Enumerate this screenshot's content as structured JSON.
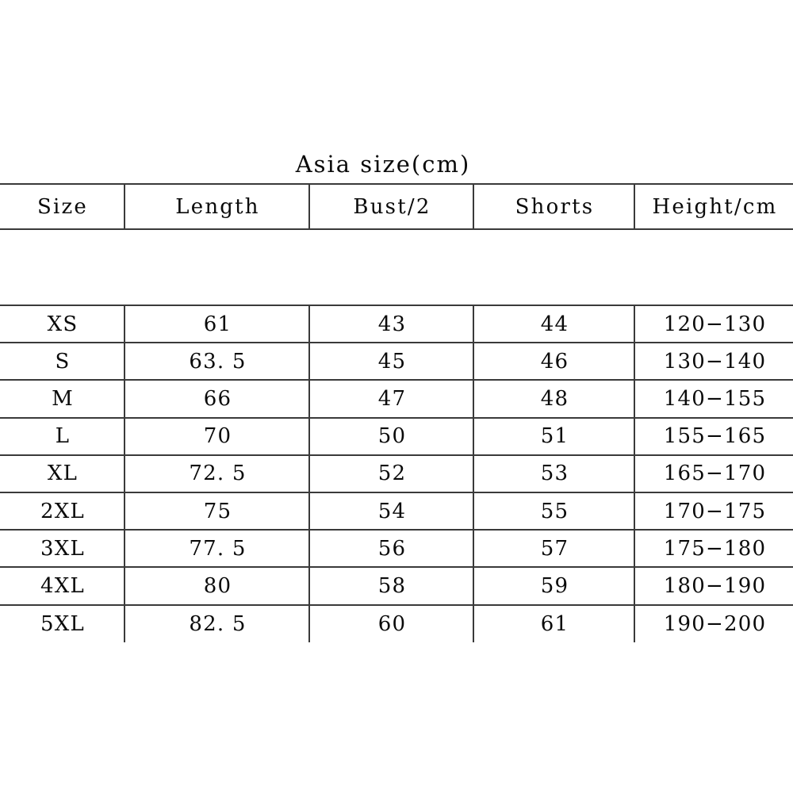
{
  "title": "Asia size(cm)",
  "table": {
    "columns": [
      "Size",
      "Length",
      "Bust/2",
      "Shorts",
      "Height/cm"
    ],
    "rows": [
      {
        "size": "XS",
        "length": "61",
        "bust": "43",
        "shorts": "44",
        "height": "120−130"
      },
      {
        "size": "S",
        "length": "63. 5",
        "bust": "45",
        "shorts": "46",
        "height": "130−140"
      },
      {
        "size": "M",
        "length": "66",
        "bust": "47",
        "shorts": "48",
        "height": "140−155"
      },
      {
        "size": "L",
        "length": "70",
        "bust": "50",
        "shorts": "51",
        "height": "155−165"
      },
      {
        "size": "XL",
        "length": "72. 5",
        "bust": "52",
        "shorts": "53",
        "height": "165−170"
      },
      {
        "size": "2XL",
        "length": "75",
        "bust": "54",
        "shorts": "55",
        "height": "170−175"
      },
      {
        "size": "3XL",
        "length": "77. 5",
        "bust": "56",
        "shorts": "57",
        "height": "175−180"
      },
      {
        "size": "4XL",
        "length": "80",
        "bust": "58",
        "shorts": "59",
        "height": "180−190"
      },
      {
        "size": "5XL",
        "length": "82. 5",
        "bust": "60",
        "shorts": "61",
        "height": "190−200"
      }
    ]
  },
  "style": {
    "border_color": "#3a3a3a",
    "text_color": "#0a0a0a",
    "background": "#ffffff"
  }
}
